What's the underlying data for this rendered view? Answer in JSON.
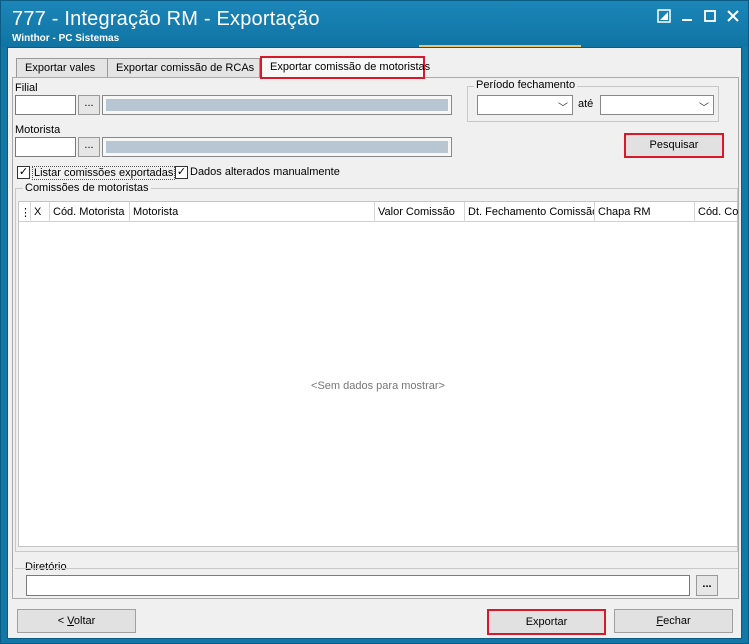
{
  "window": {
    "title": "777 - Integração RM - Exportação",
    "subtitle": "Winthor - PC Sistemas"
  },
  "tabs": [
    {
      "label": "Exportar vales"
    },
    {
      "label": "Exportar comissão de RCAs"
    },
    {
      "label": "Exportar comissão de motoristas"
    }
  ],
  "filters": {
    "filial_label": "Filial",
    "motorista_label": "Motorista",
    "ellipsis": "...",
    "periodo_label": "Período fechamento",
    "ate_label": "até",
    "pesquisar_label": "Pesquisar"
  },
  "options": {
    "listar_label": "Listar comissões exportadas",
    "dados_label": "Dados alterados manualmente",
    "listar_checked": "✓",
    "dados_checked": "✓"
  },
  "grid": {
    "group_label": "Comissões de motoristas",
    "columns": [
      "X",
      "Cód. Motorista",
      "Motorista",
      "Valor Comissão",
      "Dt. Fechamento Comissão",
      "Chapa RM",
      "Cód. Co"
    ],
    "empty_text": "<Sem dados para mostrar>"
  },
  "diretorio": {
    "label": "Diretório",
    "value": "",
    "browse": "..."
  },
  "footer": {
    "voltar_prefix": "< ",
    "voltar_rest": "Voltar",
    "voltar_u": "V",
    "exportar_label": "Exportar",
    "fechar_u": "F",
    "fechar_rest": "echar"
  }
}
